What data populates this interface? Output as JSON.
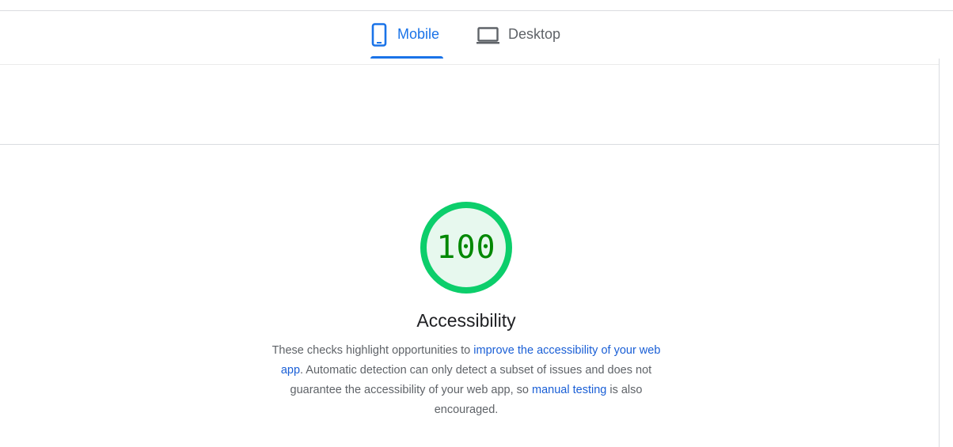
{
  "tabs": {
    "mobile": {
      "label": "Mobile",
      "active": true,
      "icon": "smartphone-icon"
    },
    "desktop": {
      "label": "Desktop",
      "active": false,
      "icon": "laptop-icon"
    }
  },
  "score": {
    "value": "100",
    "fraction": 1.0,
    "ring_color": "#0cce6b",
    "fill_color": "#e7f8ee",
    "text_color": "#008800"
  },
  "category": {
    "title": "Accessibility",
    "description": {
      "text_1": "These checks highlight opportunities to ",
      "link_1": "improve the accessibility of your web app",
      "text_2": ". Automatic detection can only detect a subset of issues and does not guarantee the accessibility of your web app, so ",
      "link_2": "manual testing",
      "text_3": " is also encouraged."
    }
  },
  "colors": {
    "accent": "#1a73e8",
    "link": "#1a5fd6",
    "pass": "#0cce6b"
  }
}
